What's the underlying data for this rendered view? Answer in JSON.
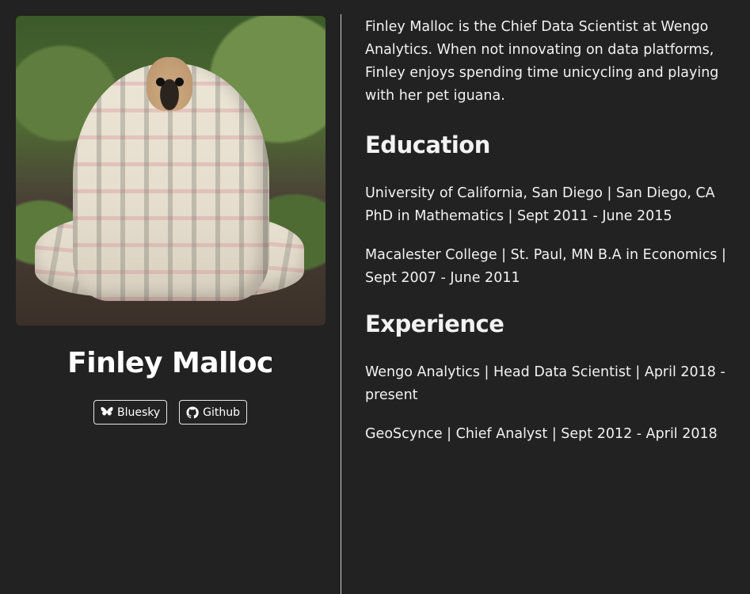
{
  "profile": {
    "name": "Finley Malloc",
    "photo_alt": "pug wrapped in a plaid blanket",
    "links": [
      {
        "label": "Bluesky",
        "icon": "butterfly-icon"
      },
      {
        "label": "Github",
        "icon": "github-icon"
      }
    ]
  },
  "about": {
    "bio": "Finley Malloc is the Chief Data Scientist at Wengo Analytics. When not innovating on data platforms, Finley enjoys spending time unicycling and playing with her pet iguana."
  },
  "education": {
    "heading": "Education",
    "entries": [
      "University of California, San Diego | San Diego, CA PhD in Mathematics | Sept 2011 - June 2015",
      "Macalester College | St. Paul, MN B.A in Economics | Sept 2007 - June 2011"
    ]
  },
  "experience": {
    "heading": "Experience",
    "entries": [
      "Wengo Analytics | Head Data Scientist | April 2018 - present",
      "GeoScynce | Chief Analyst | Sept 2012 - April 2018"
    ]
  },
  "colors": {
    "background": "#222222",
    "text": "#f2f2f2",
    "divider": "#cfcfcf"
  }
}
